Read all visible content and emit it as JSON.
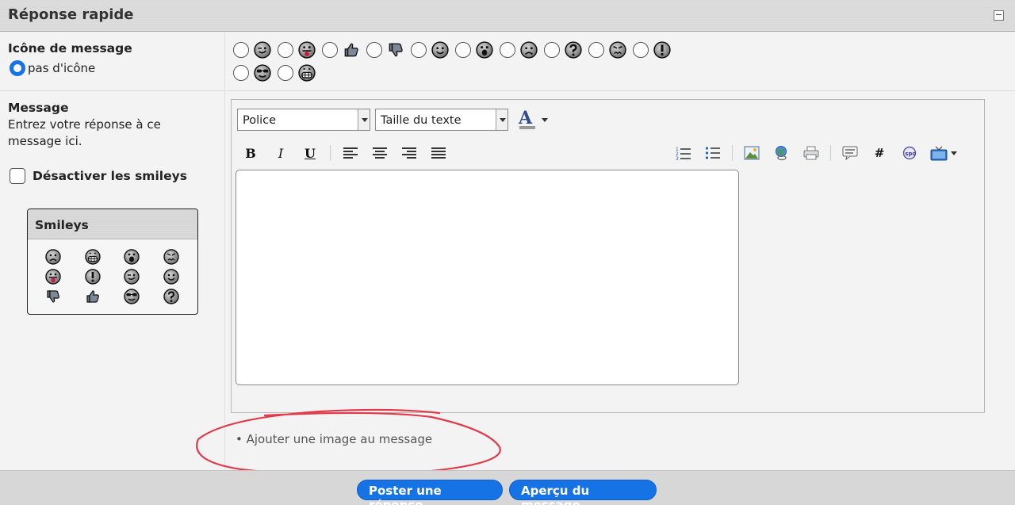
{
  "header": {
    "title": "Réponse rapide",
    "collapse_symbol": "−"
  },
  "message_icon": {
    "label": "Icône de message",
    "no_icon_label": "pas d'icône",
    "icons": [
      "wink",
      "tongue",
      "thumbs-up",
      "thumbs-down",
      "smile",
      "surprised",
      "sad",
      "question",
      "angry",
      "exclamation",
      "cool",
      "grin"
    ]
  },
  "message": {
    "label": "Message",
    "help": "Entrez votre réponse à ce message ici.",
    "disable_smileys_label": "Désactiver les smileys"
  },
  "smileys": {
    "title": "Smileys",
    "items": [
      "sad",
      "grin",
      "surprised",
      "angry",
      "tongue",
      "exclamation",
      "wink",
      "smile",
      "thumbs-down",
      "thumbs-up",
      "cool",
      "question"
    ]
  },
  "editor": {
    "font_select": "Police",
    "size_select": "Taille du texte",
    "color_letter": "A",
    "bold": "B",
    "italic": "I",
    "underline": "U",
    "hash": "#",
    "textarea_value": ""
  },
  "attach_link": "Ajouter une image au message",
  "buttons": {
    "post": "Poster une réponse",
    "preview": "Aperçu du message"
  },
  "colors": {
    "accent": "#1673e6",
    "annotation": "#e23a4a"
  }
}
